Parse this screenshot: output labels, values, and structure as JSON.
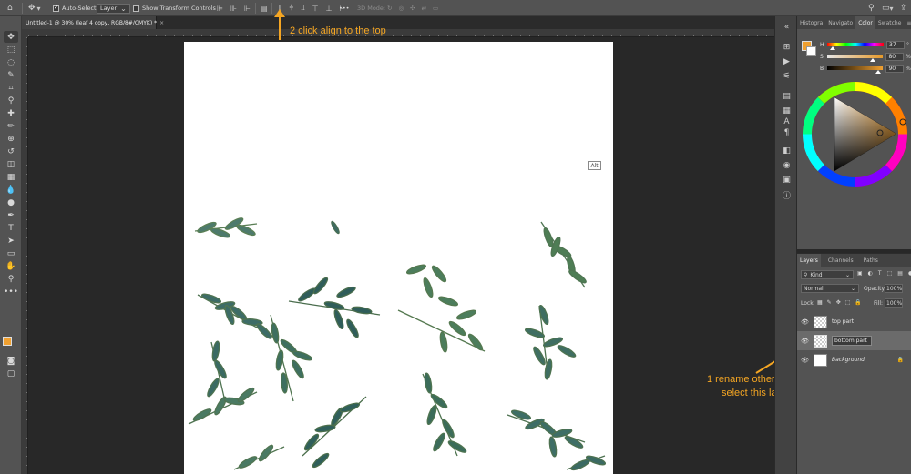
{
  "options_bar": {
    "home_icon": "home-icon",
    "move_icon": "move-tool-icon",
    "auto_select_label": "Auto-Select:",
    "auto_select_value": "Layer",
    "show_transform_label": "Show Transform Controls",
    "mode_3d_label": "3D Mode:",
    "more_label": "•••"
  },
  "document_tab": {
    "title": "Untitled-1 @ 30% (leaf 4 copy, RGB/8#/CMYK) *",
    "close": "×"
  },
  "annotations": {
    "align_top": "2  click align to the top",
    "rename_line1": "1  rename other layer",
    "rename_line2": "select this layer & background layer"
  },
  "canvas": {
    "alt_badge": "Alt"
  },
  "color_panel": {
    "tabs": [
      "Histogra",
      "Navigato",
      "Color",
      "Swatche"
    ],
    "active_tab": "Color",
    "foreground_color": "#f0a030",
    "sliders": [
      {
        "label": "H",
        "value": "37",
        "unit": "°",
        "fraction": 0.1
      },
      {
        "label": "S",
        "value": "80",
        "unit": "%",
        "fraction": 0.8
      },
      {
        "label": "B",
        "value": "90",
        "unit": "%",
        "fraction": 0.9
      }
    ]
  },
  "layers_panel": {
    "tabs": [
      "Layers",
      "Channels",
      "Paths"
    ],
    "active_tab": "Layers",
    "kind_label": "Kind",
    "blend_mode": "Normal",
    "opacity_label": "Opacity:",
    "opacity_value": "100%",
    "lock_label": "Lock:",
    "fill_label": "Fill:",
    "fill_value": "100%",
    "layers": [
      {
        "name": "top part",
        "thumb": "transparent",
        "selected": false
      },
      {
        "name": "bottom part",
        "thumb": "transparent",
        "selected": true
      },
      {
        "name": "Background",
        "thumb": "white",
        "selected": false
      }
    ]
  },
  "colors": {
    "annotation": "#f5a623",
    "panel_bg": "#535353",
    "workspace_bg": "#282828"
  }
}
